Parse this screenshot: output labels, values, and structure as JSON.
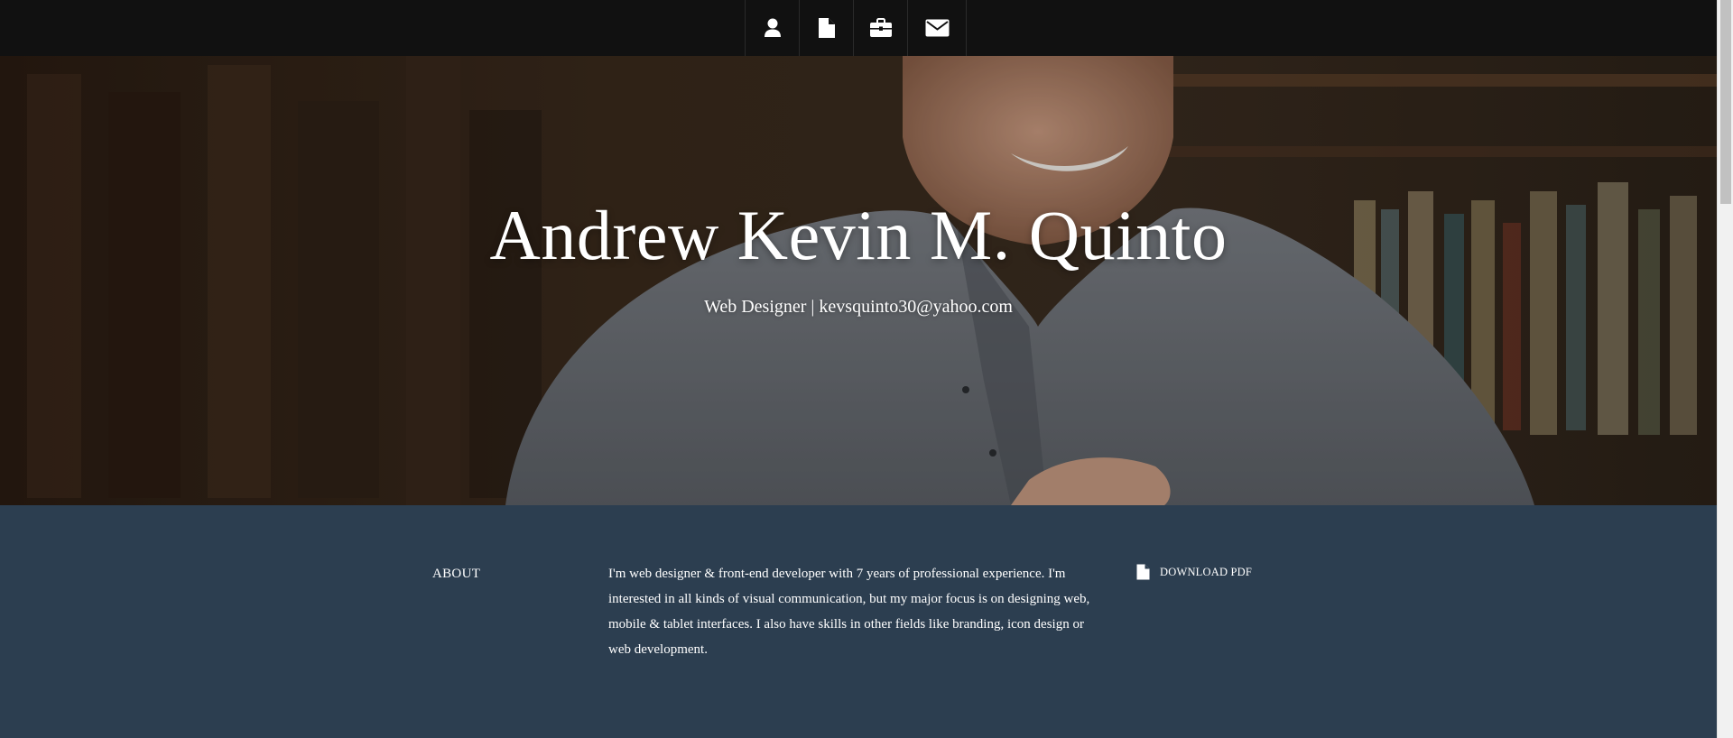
{
  "nav": {
    "items": [
      {
        "icon": "user-icon"
      },
      {
        "icon": "document-icon"
      },
      {
        "icon": "briefcase-icon"
      },
      {
        "icon": "envelope-icon"
      }
    ]
  },
  "hero": {
    "name": "Andrew Kevin M. Quinto",
    "subtitle": "Web Designer | kevsquinto30@yahoo.com"
  },
  "about": {
    "heading": "ABOUT",
    "text": "I'm web designer & front-end developer with 7 years of professional experience. I'm interested in all kinds of visual communication, but my major focus is on designing web, mobile & tablet interfaces. I also have skills in other fields like branding, icon design or web development.",
    "download_label": "DOWNLOAD PDF",
    "download_icon": "document-icon"
  },
  "colors": {
    "nav_bg": "#111111",
    "about_bg": "#2c3e50",
    "text": "#ffffff"
  }
}
